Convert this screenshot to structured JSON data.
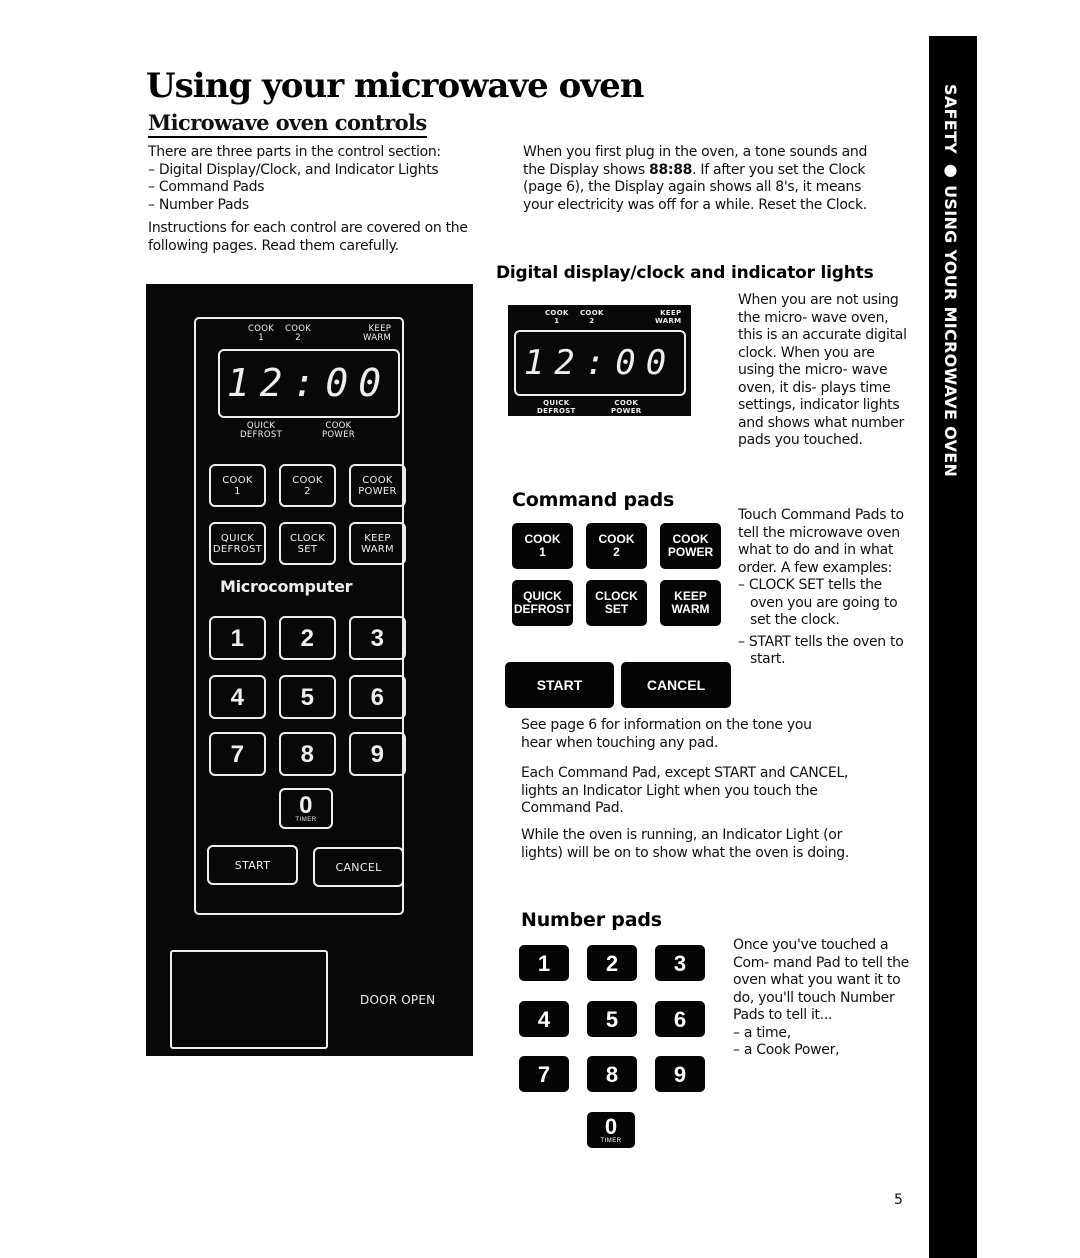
{
  "page": {
    "title": "Using your microwave oven",
    "subtitle": "Microwave oven controls",
    "page_number": "5",
    "side_tab": "SAFETY ● USING YOUR MICROWAVE OVEN"
  },
  "intro": {
    "lead": "There are three parts in the control section:",
    "items": [
      "– Digital Display/Clock, and Indicator Lights",
      "– Command Pads",
      "– Number Pads"
    ],
    "instructions": "Instructions for each control are covered on the following pages. Read them carefully."
  },
  "plug_in": {
    "text_before": "When you first plug in the oven, a tone sounds and the Display shows ",
    "display_value": "88:88",
    "text_after": ". If after you set the Clock (page 6), the Display again shows all 8's, it means your electricity was off for a while. Reset the Clock."
  },
  "oven_panel": {
    "indicators_top": {
      "cook1": "COOK\n1",
      "cook2": "COOK\n2",
      "keep_warm": "KEEP\nWARM"
    },
    "indicators_bottom": {
      "quick_defrost": "QUICK\nDEFROST",
      "cook_power": "COOK\nPOWER"
    },
    "display_time": "12:00",
    "command_pads": [
      {
        "label": "COOK\n1"
      },
      {
        "label": "COOK\n2"
      },
      {
        "label": "COOK\nPOWER"
      },
      {
        "label": "QUICK\nDEFROST"
      },
      {
        "label": "CLOCK\nSET"
      },
      {
        "label": "KEEP\nWARM"
      }
    ],
    "brand": "Microcomputer",
    "number_pads": [
      "1",
      "2",
      "3",
      "4",
      "5",
      "6",
      "7",
      "8",
      "9"
    ],
    "zero_pad": {
      "digit": "0",
      "sub": "TIMER"
    },
    "start": "START",
    "cancel": "CANCEL",
    "door_open": "DOOR OPEN"
  },
  "digital_display": {
    "heading": "Digital display/clock and indicator lights",
    "text": "When you are not using the micro- wave oven, this is an accurate digital clock. When you are using the micro- wave oven, it dis- plays time settings, indicator lights and shows what number pads you touched."
  },
  "command_section": {
    "heading": "Command pads",
    "pads": [
      {
        "label": "COOK\n1"
      },
      {
        "label": "COOK\n2"
      },
      {
        "label": "COOK\nPOWER"
      },
      {
        "label": "QUICK\nDEFROST"
      },
      {
        "label": "CLOCK\nSET"
      },
      {
        "label": "KEEP\nWARM"
      }
    ],
    "start": "START",
    "cancel": "CANCEL",
    "text": "Touch Command Pads to tell the microwave oven what to do and in what order. A few examples:",
    "examples": [
      "– CLOCK SET tells the oven you are going to set the clock.",
      "– START tells the oven to start."
    ],
    "tone_note": "See page 6 for information on the tone you hear when touching any pad.",
    "para1": "Each Command Pad, except START and CANCEL, lights an Indicator Light when you touch the Command Pad.",
    "para2": "While the oven is running, an Indicator Light (or lights) will be on to show what the oven is doing."
  },
  "number_section": {
    "heading": "Number pads",
    "pads": [
      "1",
      "2",
      "3",
      "4",
      "5",
      "6",
      "7",
      "8",
      "9"
    ],
    "zero_pad": {
      "digit": "0",
      "sub": "TIMER"
    },
    "text": "Once you've touched a Com- mand Pad to tell the oven what you want it to do, you'll touch Number Pads to tell it...",
    "list": [
      "– a time,",
      "– a Cook Power,"
    ]
  }
}
